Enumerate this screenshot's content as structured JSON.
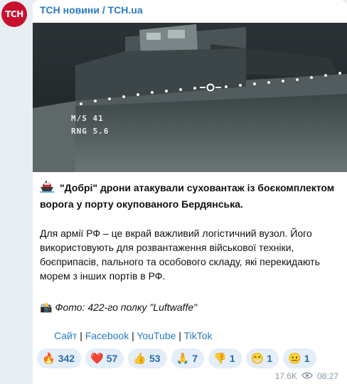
{
  "channel": {
    "name": "ТСН новини / TCH.ua",
    "avatar_text": "TCH"
  },
  "osd": {
    "speed": "M/S   41",
    "range": "RNG   5.6"
  },
  "post": {
    "headline": "\"Добрі\" дрони атакували суховантаж із боєкомплектом ворога у порту окупованого Бердянська.",
    "body": "Для армії РФ – це вкрай важливий логістичний вузол. Його використовують для розвантаження військової техніки, боєприпасів, пального та особового складу, які перекидають морем з інших портів в РФ.",
    "photo_credit": "Фото: 422-го полку \"Luftwaffe\""
  },
  "links": {
    "site": "Сайт",
    "facebook": "Facebook",
    "youtube": "YouTube",
    "tiktok": "TikTok",
    "sep": "|"
  },
  "reactions": [
    {
      "icon": "fire-icon",
      "emoji": "🔥",
      "count": "342"
    },
    {
      "icon": "heart-icon",
      "emoji": "❤️",
      "count": "57"
    },
    {
      "icon": "thumbs-up-icon",
      "emoji": "👍",
      "count": "53"
    },
    {
      "icon": "pray-icon",
      "emoji": "🙏",
      "count": "7"
    },
    {
      "icon": "thumbs-down-icon",
      "emoji": "👎",
      "count": "1"
    },
    {
      "icon": "grin-icon",
      "emoji": "😁",
      "count": "1"
    },
    {
      "icon": "neutral-face-icon",
      "emoji": "😐",
      "count": "1"
    }
  ],
  "meta": {
    "views": "17.6K",
    "time": "08:27"
  },
  "colors": {
    "accent": "#2a7ac0",
    "reaction_bg": "#e3eef8",
    "brand": "#c8102e"
  }
}
